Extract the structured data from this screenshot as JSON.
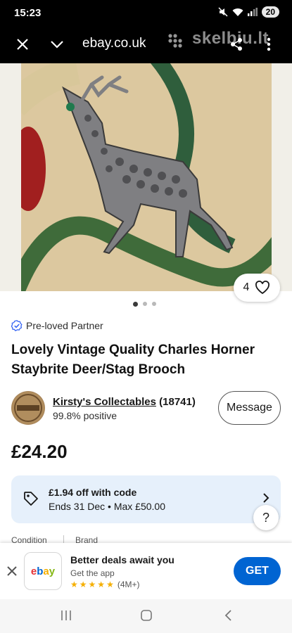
{
  "status_bar": {
    "time": "15:23",
    "battery": "20"
  },
  "browser": {
    "url": "ebay.co.uk"
  },
  "watermark": {
    "text": "skelbiu.lt"
  },
  "listing": {
    "favorite_count": "4",
    "carousel": {
      "total": 3,
      "active": 1
    },
    "badge": "Pre-loved Partner",
    "title": "Lovely Vintage Quality Charles Horner Staybrite Deer/Stag Brooch",
    "seller": {
      "name": "Kirsty's Collectables",
      "feedback_count": "(18741)",
      "positive": "99.8% positive"
    },
    "message_label": "Message",
    "price": "£24.20",
    "coupon": {
      "line1": "£1.94 off with code",
      "line2": "Ends 31 Dec • Max £50.00"
    },
    "help_label": "?",
    "specs": [
      "Condition",
      "Brand"
    ]
  },
  "app_banner": {
    "logo": [
      "e",
      "b",
      "a",
      "y"
    ],
    "title": "Better deals await you",
    "subtitle": "Get the app",
    "rating_count": "(4M+)",
    "stars": 5,
    "get_label": "GET"
  },
  "colors": {
    "ebay_blue": "#0064d2",
    "coupon_bg": "#e6f0fb",
    "verified_blue": "#3665f3"
  }
}
